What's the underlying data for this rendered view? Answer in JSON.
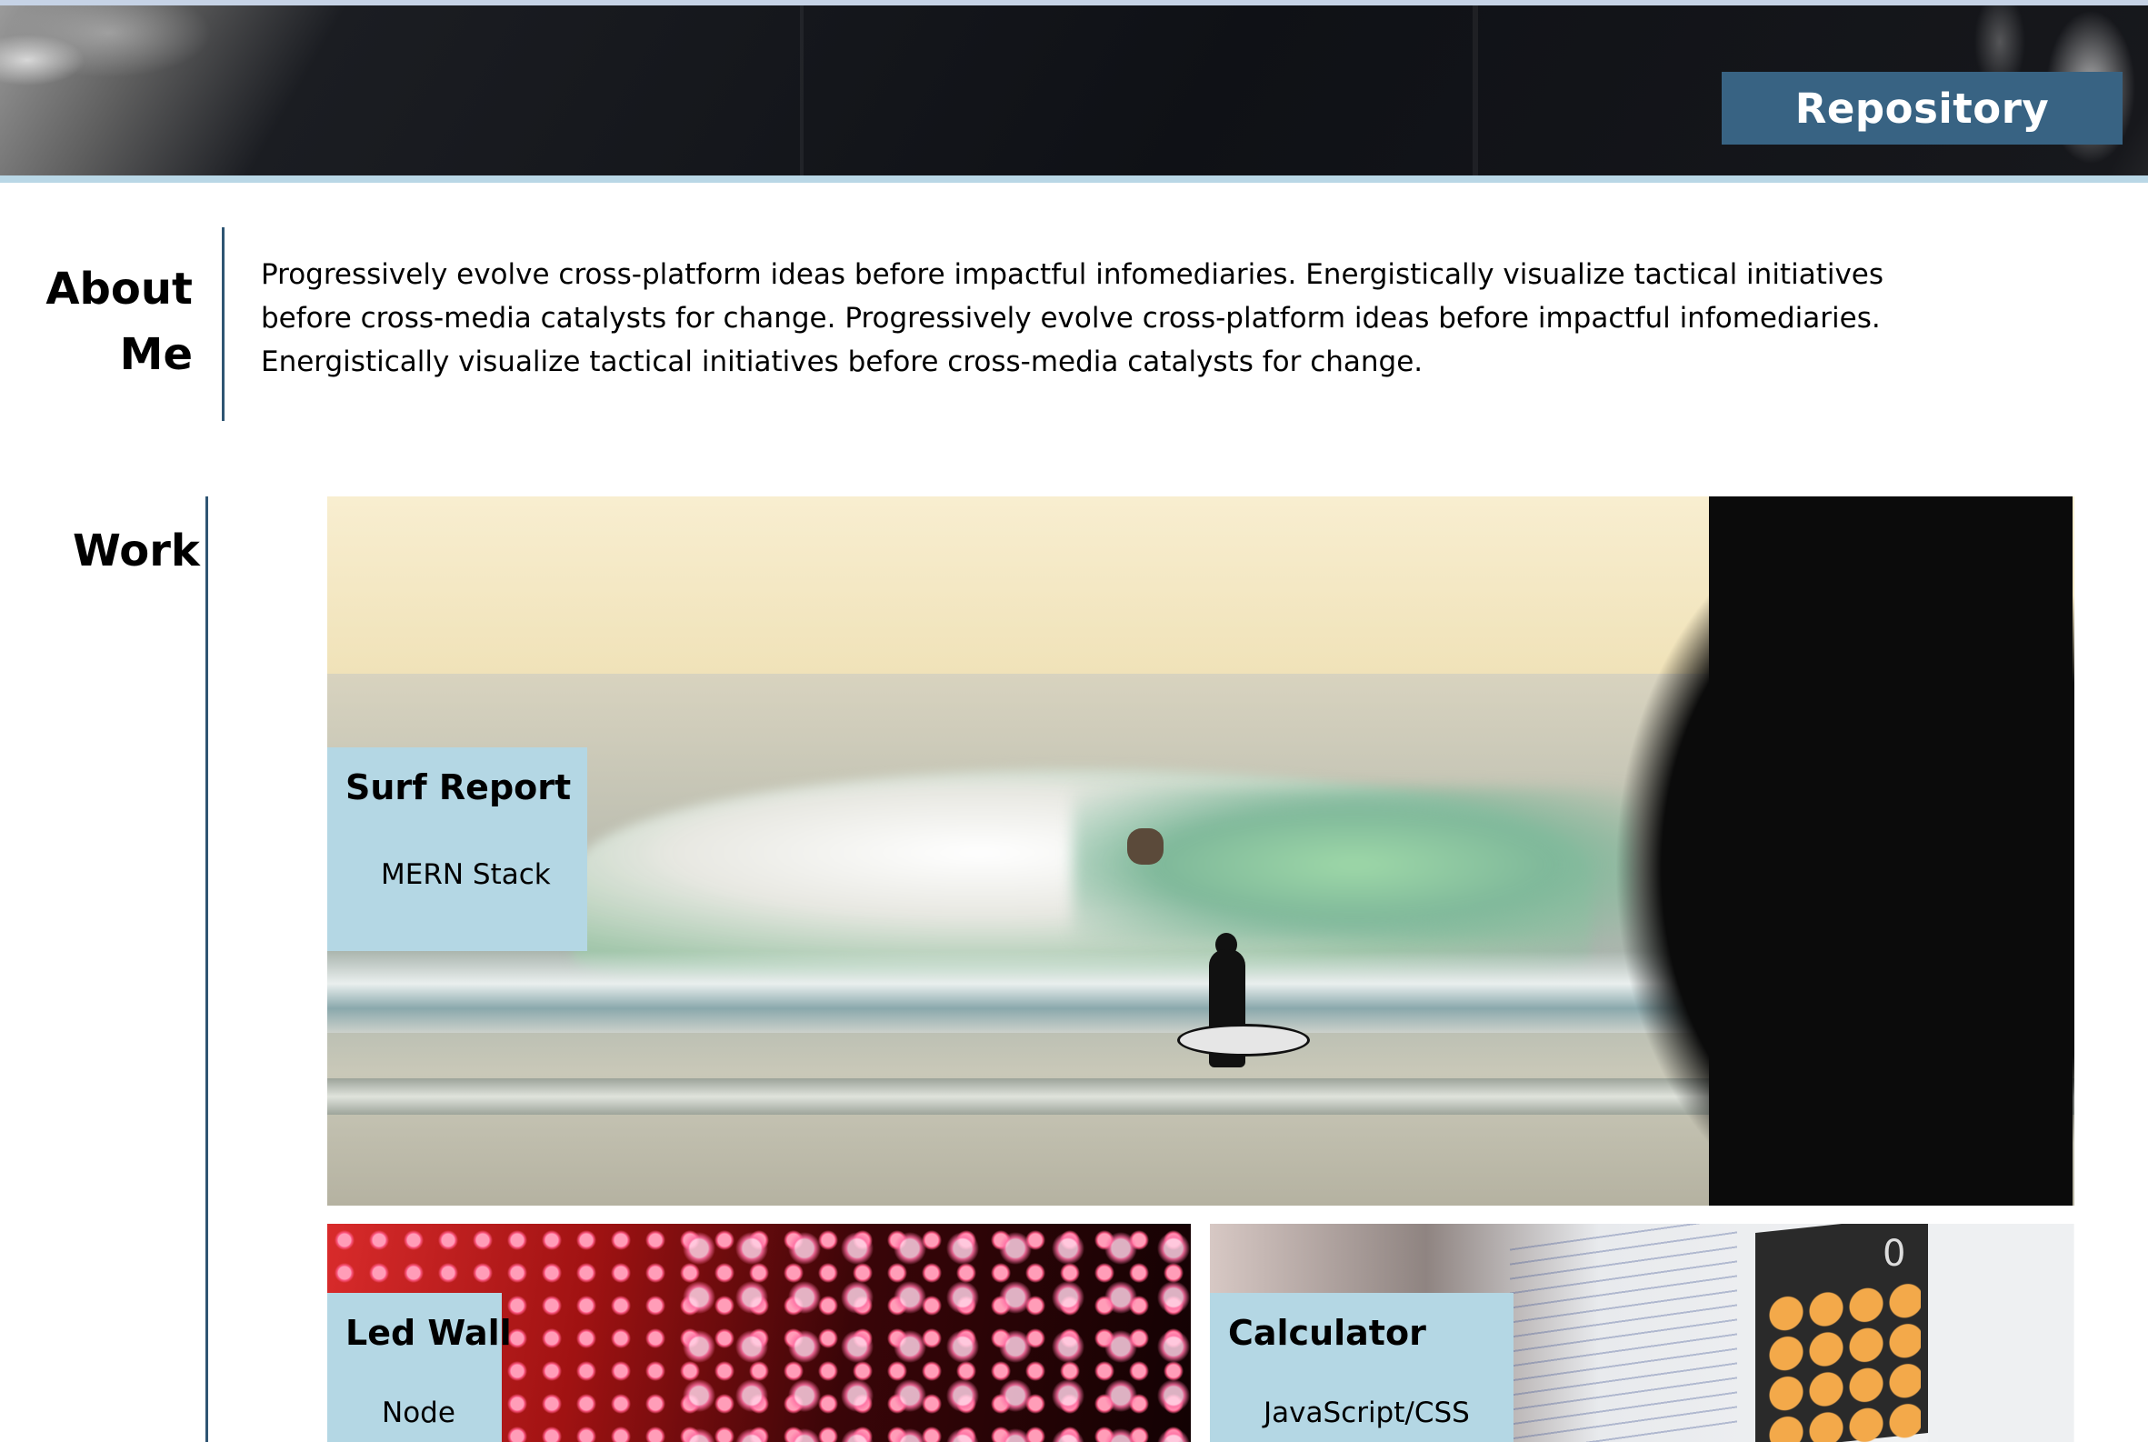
{
  "header": {
    "repository_label": "Repository"
  },
  "about": {
    "title_line1": "About",
    "title_line2": "Me",
    "text": "Progressively evolve cross-platform ideas before impactful infomediaries. Energistically visualize tactical initiatives before cross-media catalysts for change. Progressively evolve cross-platform ideas before impactful infomediaries. Energistically visualize tactical initiatives before cross-media catalysts for change."
  },
  "work": {
    "title": "Work",
    "projects": [
      {
        "title": "Surf Report",
        "subtitle": "MERN Stack"
      },
      {
        "title": "Led Wall",
        "subtitle": "Node"
      },
      {
        "title": "Calculator",
        "subtitle": "JavaScript/CSS"
      }
    ]
  },
  "colors": {
    "accent": "#386383",
    "rule": "#2f5573",
    "label_bg": "#b4d7e4",
    "band": "#b9d7e6"
  },
  "icons": {
    "calculator_display": "0"
  }
}
